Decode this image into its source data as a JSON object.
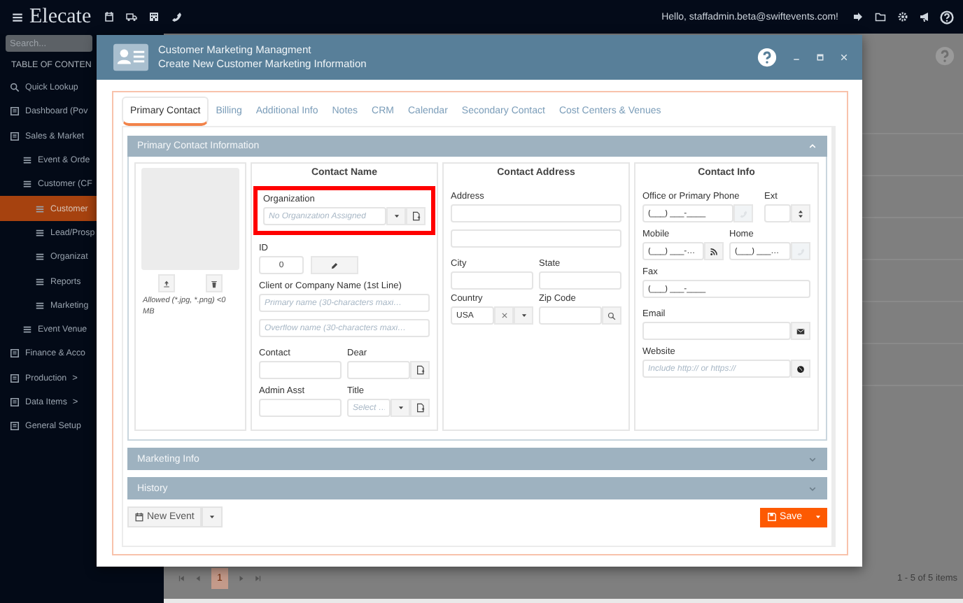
{
  "top_bar": {
    "logo": "Elecate",
    "greeting": "Hello, staffadmin.beta@swiftevents.com!"
  },
  "sidebar": {
    "search": {
      "placeholder": "Search..."
    },
    "heading": "TABLE OF CONTEN",
    "items": [
      {
        "label": "Quick Lookup",
        "selected": false
      },
      {
        "label": "Dashboard (Pov",
        "selected": false
      },
      {
        "label": "Sales & Market",
        "selected": false,
        "children": [
          {
            "label": "Event & Orde",
            "selected": false
          },
          {
            "label": "Customer (CF",
            "selected": false,
            "children": [
              {
                "label": "Customer",
                "selected": true
              },
              {
                "label": "Lead/Prosp",
                "selected": false
              },
              {
                "label": "Organizat",
                "selected": false
              },
              {
                "label": "Reports",
                "selected": false
              },
              {
                "label": "Marketing",
                "selected": false
              }
            ]
          },
          {
            "label": "Event Venue",
            "selected": false
          }
        ]
      },
      {
        "label": "Finance & Acco",
        "selected": false
      },
      {
        "label": "Production",
        "selected": false,
        "arrow": ">"
      },
      {
        "label": "Data Items",
        "selected": false,
        "arrow": ">"
      },
      {
        "label": "General Setup",
        "selected": false
      }
    ]
  },
  "pager": {
    "pages": [
      {
        "label": "1",
        "selected": true
      }
    ],
    "summary": "1 - 5 of 5 items"
  },
  "dialog": {
    "title": "Customer Marketing Managment",
    "subtitle": "Create New Customer Marketing Information",
    "tabs": [
      {
        "label": "Primary Contact",
        "selected": true
      },
      {
        "label": "Billing",
        "selected": false
      },
      {
        "label": "Additional Info",
        "selected": false
      },
      {
        "label": "Notes",
        "selected": false
      },
      {
        "label": "CRM",
        "selected": false
      },
      {
        "label": "Calendar",
        "selected": false
      },
      {
        "label": "Secondary Contact",
        "selected": false
      },
      {
        "label": "Cost Centers & Venues",
        "selected": false
      }
    ],
    "sections": [
      {
        "title": "Primary Contact Information",
        "expanded": true
      },
      {
        "title": "Marketing Info",
        "expanded": false
      },
      {
        "title": "History",
        "expanded": false
      }
    ],
    "photo": {
      "note": "Allowed (*.jpg, *.png) <0 MB"
    },
    "contact_name": {
      "heading": "Contact Name",
      "organization": {
        "label": "Organization",
        "placeholder": "No Organization Assigned",
        "highlighted": true
      },
      "id": {
        "label": "ID",
        "value": "0"
      },
      "company": {
        "label": "Client or Company Name (1st Line)",
        "primary_placeholder": "Primary name (30-characters maxi…",
        "overflow_placeholder": "Overflow name (30-characters maxi…"
      },
      "contact": {
        "label": "Contact"
      },
      "dear": {
        "label": "Dear"
      },
      "admin_asst": {
        "label": "Admin Asst"
      },
      "title": {
        "label": "Title",
        "placeholder": "Select …"
      }
    },
    "contact_address": {
      "heading": "Contact Address",
      "address": {
        "label": "Address"
      },
      "city": {
        "label": "City"
      },
      "state": {
        "label": "State"
      },
      "country": {
        "label": "Country",
        "value": "USA"
      },
      "zip": {
        "label": "Zip Code"
      }
    },
    "contact_info": {
      "heading": "Contact Info",
      "office": {
        "label": "Office or Primary Phone",
        "value": "(___) ___-____"
      },
      "ext": {
        "label": "Ext"
      },
      "mobile": {
        "label": "Mobile",
        "value": "(___) ___-…"
      },
      "home": {
        "label": "Home",
        "value": "(___) ___…"
      },
      "fax": {
        "label": "Fax",
        "value": "(___) ___-____"
      },
      "email": {
        "label": "Email"
      },
      "website": {
        "label": "Website",
        "placeholder": "Include http:// or https://"
      }
    },
    "footer": {
      "new_event": "New Event",
      "save": "Save"
    }
  }
}
